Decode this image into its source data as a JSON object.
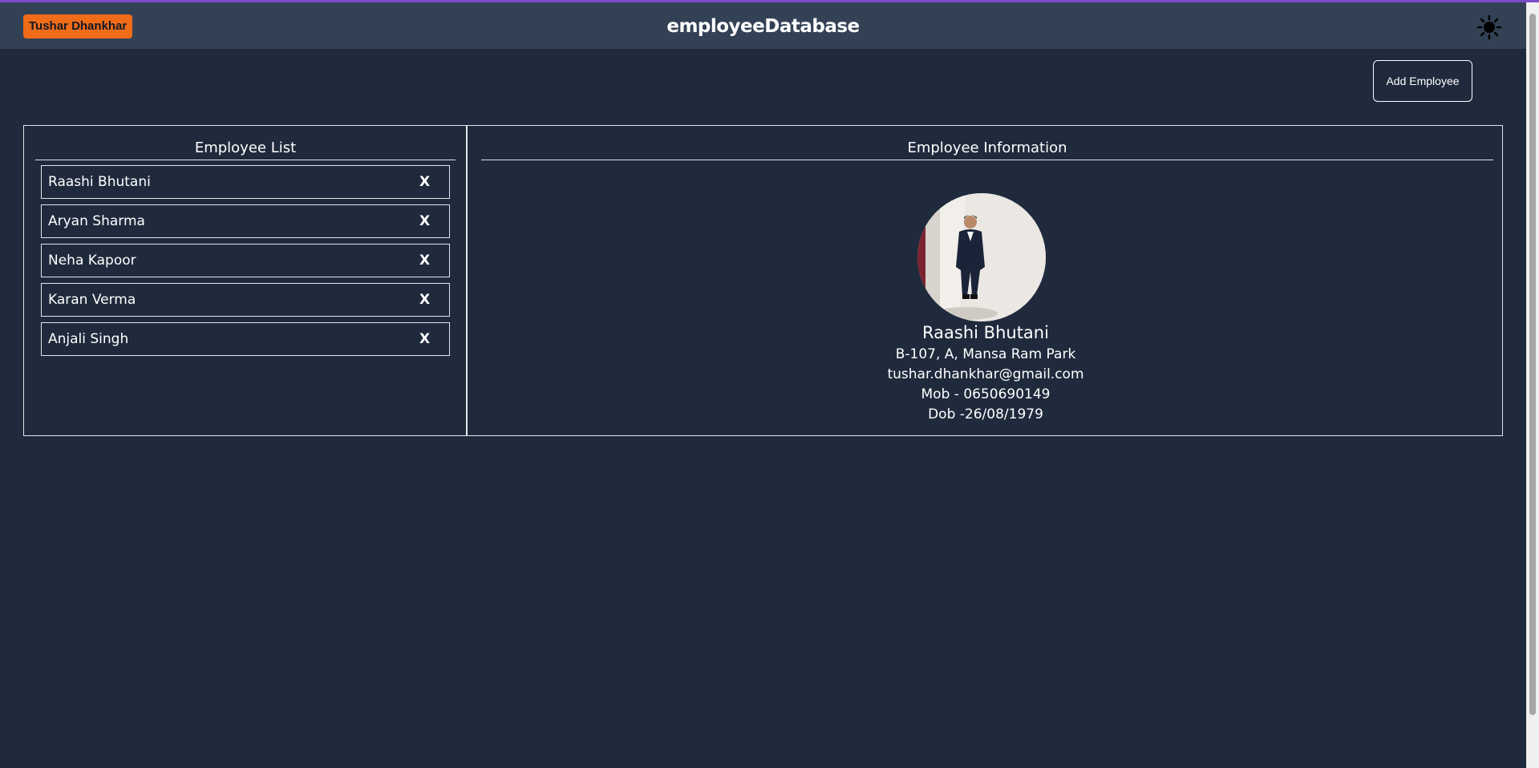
{
  "header": {
    "user_name": "Tushar Dhankhar",
    "app_title": "employeeDatabase",
    "theme_icon": "sun-icon"
  },
  "toolbar": {
    "add_label": "Add Employee"
  },
  "list_panel": {
    "title": "Employee List",
    "delete_label": "X",
    "items": [
      {
        "name": "Raashi Bhutani"
      },
      {
        "name": "Aryan Sharma"
      },
      {
        "name": "Neha Kapoor"
      },
      {
        "name": "Karan Verma"
      },
      {
        "name": "Anjali Singh"
      }
    ]
  },
  "info_panel": {
    "title": "Employee Information",
    "name": "Raashi Bhutani",
    "address": "B-107, A, Mansa Ram Park",
    "email": "tushar.dhankhar@gmail.com",
    "mobile": "Mob - 0650690149",
    "dob": "Dob -26/08/1979"
  },
  "colors": {
    "background": "#1f2a3c",
    "header": "#334155",
    "accent": "#7c4dca",
    "badge": "#f16c18"
  }
}
